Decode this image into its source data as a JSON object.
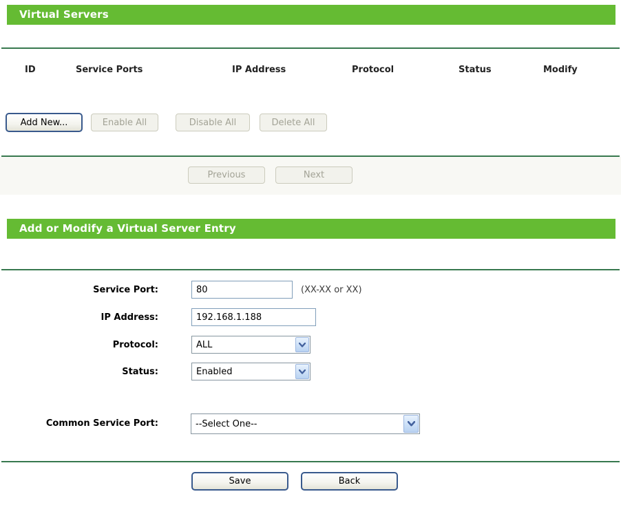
{
  "colors": {
    "header_green": "#65bb33",
    "divider_green": "#37784e",
    "disabled_text": "#a3a396",
    "input_border": "#7f9db9"
  },
  "virtual_servers": {
    "title": "Virtual Servers",
    "columns": [
      "ID",
      "Service Ports",
      "IP Address",
      "Protocol",
      "Status",
      "Modify"
    ],
    "toolbar": {
      "add_new": "Add New...",
      "enable_all": "Enable All",
      "disable_all": "Disable All",
      "delete_all": "Delete All"
    },
    "pagination": {
      "previous": "Previous",
      "next": "Next"
    }
  },
  "entry_form": {
    "title": "Add or Modify a Virtual Server Entry",
    "fields": {
      "service_port": {
        "label": "Service Port:",
        "value": "80",
        "hint": "(XX-XX or XX)"
      },
      "ip_address": {
        "label": "IP Address:",
        "value": "192.168.1.188"
      },
      "protocol": {
        "label": "Protocol:",
        "value": "ALL"
      },
      "status": {
        "label": "Status:",
        "value": "Enabled"
      },
      "common_service_port": {
        "label": "Common Service Port:",
        "value": "--Select One--"
      }
    },
    "actions": {
      "save": "Save",
      "back": "Back"
    }
  }
}
